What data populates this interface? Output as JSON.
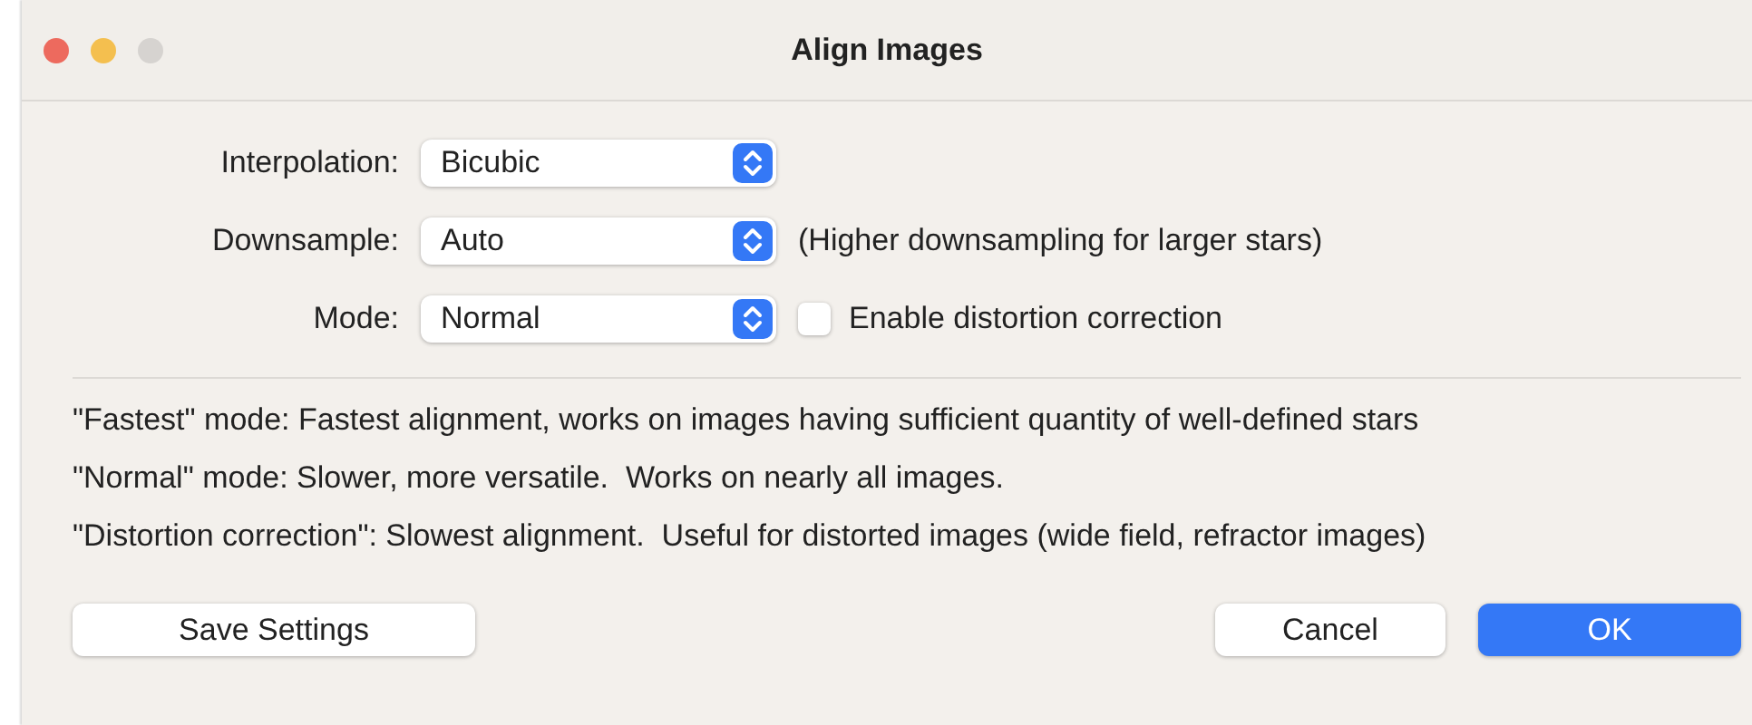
{
  "window": {
    "title": "Align Images"
  },
  "settings": [
    {
      "label": "Interpolation:",
      "value": "Bicubic"
    },
    {
      "label": "Downsample:",
      "value": "Auto",
      "note": "(Higher downsampling for larger stars)"
    },
    {
      "label": "Mode:",
      "value": "Normal",
      "checkbox": {
        "label": "Enable distortion correction",
        "checked": false
      }
    }
  ],
  "notes": [
    "\"Fastest\" mode: Fastest alignment, works on images having sufficient quantity of well-defined stars",
    "\"Normal\" mode: Slower, more versatile.  Works on nearly all images.",
    "\"Distortion correction\": Slowest alignment.  Useful for distorted images (wide field, refractor images)"
  ],
  "buttons": [
    {
      "label": "Save Settings",
      "kind": "plain"
    },
    {
      "label": "Cancel",
      "kind": "plain"
    },
    {
      "label": "OK",
      "kind": "default"
    }
  ]
}
